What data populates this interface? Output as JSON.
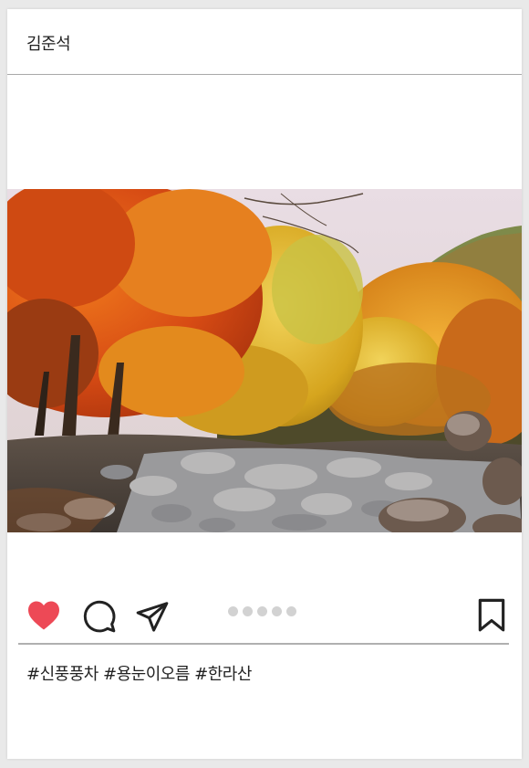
{
  "post": {
    "username": "김준석",
    "photo": {
      "description": "autumn valley with orange and yellow maple trees over a rocky dry stream bed",
      "colors": {
        "sky": "#e6dde3",
        "foliage_orange": "#d9531a",
        "foliage_yellow": "#e0b124",
        "rocks": "#8d8d90"
      }
    },
    "actions": {
      "like_icon": "heart-icon",
      "comment_icon": "comment-icon",
      "share_icon": "send-icon",
      "save_icon": "bookmark-icon",
      "like_color": "#ed4956",
      "carousel_dot_count": 5
    },
    "caption": "#신풍풍차 #용눈이오름 #한라산"
  }
}
